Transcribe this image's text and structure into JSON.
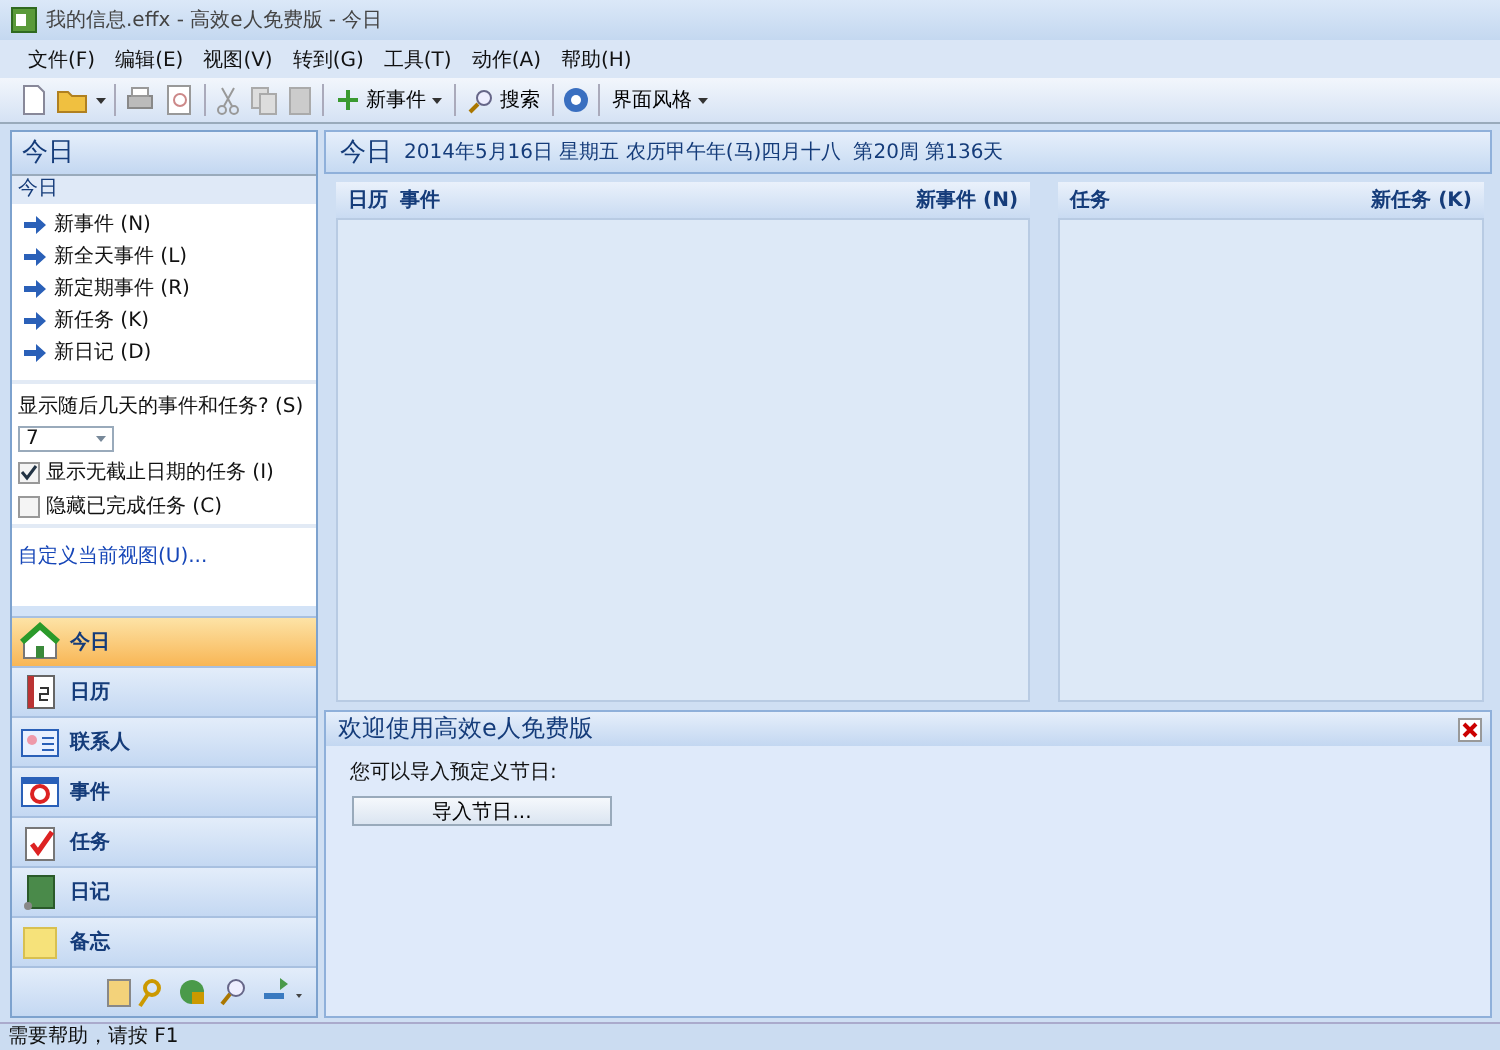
{
  "window": {
    "title": "我的信息.effx - 高效e人免费版 - 今日"
  },
  "menu": [
    "文件(F)",
    "编辑(E)",
    "视图(V)",
    "转到(G)",
    "工具(T)",
    "动作(A)",
    "帮助(H)"
  ],
  "toolbar": {
    "new_event": "新事件",
    "search": "搜索",
    "theme": "界面风格"
  },
  "left": {
    "title": "今日",
    "section": "今日",
    "actions": [
      "新事件 (N)",
      "新全天事件 (L)",
      "新定期事件 (R)",
      "新任务 (K)",
      "新日记 (D)"
    ],
    "days_question": "显示随后几天的事件和任务? (S)",
    "days_value": "7",
    "checkboxes": [
      {
        "label": "显示无截止日期的任务 (I)",
        "checked": true
      },
      {
        "label": "隐藏已完成任务 (C)",
        "checked": false
      }
    ],
    "link": "自定义当前视图(U)..."
  },
  "nav": [
    {
      "label": "今日",
      "selected": true
    },
    {
      "label": "日历",
      "selected": false
    },
    {
      "label": "联系人",
      "selected": false
    },
    {
      "label": "事件",
      "selected": false
    },
    {
      "label": "任务",
      "selected": false
    },
    {
      "label": "日记",
      "selected": false
    },
    {
      "label": "备忘",
      "selected": false
    }
  ],
  "header": {
    "title": "今日",
    "date": "2014年5月16日 星期五 农历甲午年(马)四月十八",
    "week": "第20周 第136天"
  },
  "events": {
    "col1": "日历",
    "col2": "事件",
    "action": "新事件 (N)"
  },
  "tasks": {
    "col1": "任务",
    "action": "新任务 (K)"
  },
  "welcome": {
    "title": "欢迎使用高效e人免费版",
    "text": "您可以导入预定义节日:",
    "button": "导入节日..."
  },
  "status_bar": "需要帮助，请按 F1"
}
